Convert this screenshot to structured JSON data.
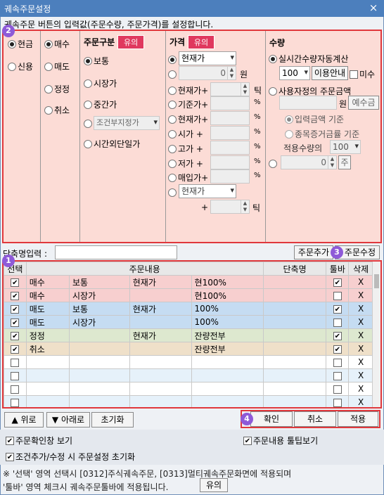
{
  "window": {
    "title": "궤속주문설정",
    "close_glyph": "×"
  },
  "description": "궤속주문 버튼의 입력값(주문수량, 주문가격)를 설정합니다.",
  "markers": {
    "settings": "2",
    "grid": "1",
    "modify": "3",
    "actions": "4"
  },
  "account": {
    "options": [
      "현금",
      "신용"
    ],
    "selected": "현금"
  },
  "side": {
    "options": [
      "매수",
      "매도",
      "정정",
      "취소"
    ],
    "selected": "매수"
  },
  "order_type": {
    "header": "주문구분",
    "badge": "유의",
    "options": [
      "보통",
      "시장가",
      "중간가",
      "시간외단일가"
    ],
    "selected": "보통",
    "condition_label": "조건부지정가"
  },
  "price": {
    "header": "가격",
    "badge": "유의",
    "select_value": "현재가",
    "input_value": "0",
    "won": "원",
    "tick": "틱",
    "rows": [
      "현재가+",
      "기준가+",
      "현재가+",
      "시가 +",
      "고가 +",
      "저가 +",
      "매입가+"
    ],
    "pct": "%",
    "bottom_select": "현재가",
    "plus": "+",
    "bottom_tick": "틱"
  },
  "qty": {
    "header": "수량",
    "auto_label": "실시간수량자동계산",
    "auto_value": "100",
    "usage_btn": "이용안내",
    "misu": "미수",
    "custom_label": "사용자정의 주문금액",
    "won": "원",
    "deposit_btn": "예수금",
    "sub1": "입력금액 기준",
    "sub2": "종목증거금률 기준",
    "apply_qty_label": "적용수량의",
    "apply_qty_value": "100",
    "custom_value": "0",
    "ju": "주"
  },
  "shortname": {
    "label": "단축명입력 :",
    "value": "",
    "add_btn": "주문추가",
    "modify_btn": "주문수정"
  },
  "table": {
    "headers": [
      "선택",
      "주문내용",
      "단축명",
      "툴바",
      "삭제"
    ],
    "rows": [
      {
        "sel": true,
        "side": "매수",
        "type": "보통",
        "price": "현재가",
        "qty": "현100%",
        "short": "",
        "tb": true,
        "del": "X",
        "bg": "#f7cfcf"
      },
      {
        "sel": true,
        "side": "매수",
        "type": "시장가",
        "price": "",
        "qty": "현100%",
        "short": "",
        "tb": false,
        "del": "X",
        "bg": "#f7cfcf"
      },
      {
        "sel": true,
        "side": "매도",
        "type": "보통",
        "price": "현재가",
        "qty": "100%",
        "short": "",
        "tb": true,
        "del": "X",
        "bg": "#c5dcf2"
      },
      {
        "sel": true,
        "side": "매도",
        "type": "시장가",
        "price": "",
        "qty": "100%",
        "short": "",
        "tb": false,
        "del": "X",
        "bg": "#c5dcf2"
      },
      {
        "sel": true,
        "side": "정정",
        "type": "",
        "price": "현재가",
        "qty": "잔량전부",
        "short": "",
        "tb": true,
        "del": "X",
        "bg": "#dde8cf"
      },
      {
        "sel": true,
        "side": "취소",
        "type": "",
        "price": "",
        "qty": "잔량전부",
        "short": "",
        "tb": true,
        "del": "X",
        "bg": "#efe0c9"
      },
      {
        "sel": false,
        "side": "",
        "type": "",
        "price": "",
        "qty": "",
        "short": "",
        "tb": false,
        "del": "X",
        "bg": "#ffffff"
      },
      {
        "sel": false,
        "side": "",
        "type": "",
        "price": "",
        "qty": "",
        "short": "",
        "tb": false,
        "del": "X",
        "bg": "#e6f1fa"
      },
      {
        "sel": false,
        "side": "",
        "type": "",
        "price": "",
        "qty": "",
        "short": "",
        "tb": false,
        "del": "X",
        "bg": "#ffffff"
      },
      {
        "sel": false,
        "side": "",
        "type": "",
        "price": "",
        "qty": "",
        "short": "",
        "tb": false,
        "del": "X",
        "bg": "#e6f1fa"
      }
    ]
  },
  "nav": {
    "up": "▲ 위로",
    "down": "▼ 아래로",
    "reset": "초기화"
  },
  "actions": {
    "ok": "확인",
    "cancel": "취소",
    "apply": "적용"
  },
  "options": {
    "confirm_window": "주문확인창 보기",
    "tooltip": "주문내용 툴팁보기",
    "reset_on_add": "조건추가/수정 시 주문설정 초기화"
  },
  "footnote": {
    "line1": "※ '선택' 영역 선택시 [0312]주식궤속주문, [0313]멀티궤속주문화면에 적용되며",
    "line2": "'툴바' 영역 체크시 궤속주문툴바에 적용됩니다.",
    "badge": "유의"
  },
  "check_mark": "✔"
}
